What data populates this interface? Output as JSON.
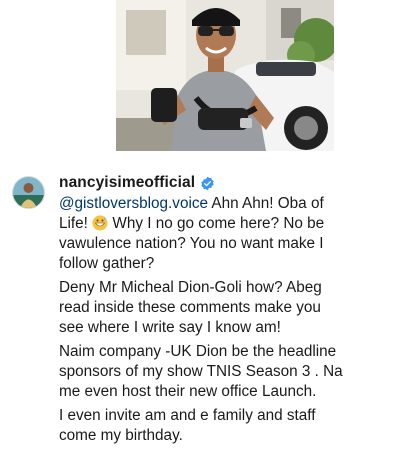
{
  "photo": {
    "alt_icon": "photo-image"
  },
  "comment": {
    "username": "nancyisimeofficial",
    "verified_icon": "verified-badge-icon",
    "mention": "@gistloversblog.voice",
    "para1_a": " Ahn Ahn! Oba of",
    "para1_b": "Life!",
    "para1_c": "Why I no go come here? No be",
    "para1_d": "vawulence nation? You no want make I",
    "para1_e": "follow gather?",
    "para2_a": "Deny Mr Micheal Dion-Goli how? Abeg",
    "para2_b": "read inside these comments make you",
    "para2_c": "see where I write say I know am!",
    "para3_a": "Naim company -UK Dion be the headline",
    "para3_b": "sponsors of my show TNIS Season 3 . Na",
    "para3_c": "me even host their new office Launch.",
    "para4_a": "I even invite am and e family and staff",
    "para4_b": "come my birthday.",
    "emoji_icon": "grinning-sweat-emoji"
  },
  "colors": {
    "mention": "#00376b",
    "verified": "#3897f0",
    "text": "#1a1a1a"
  }
}
